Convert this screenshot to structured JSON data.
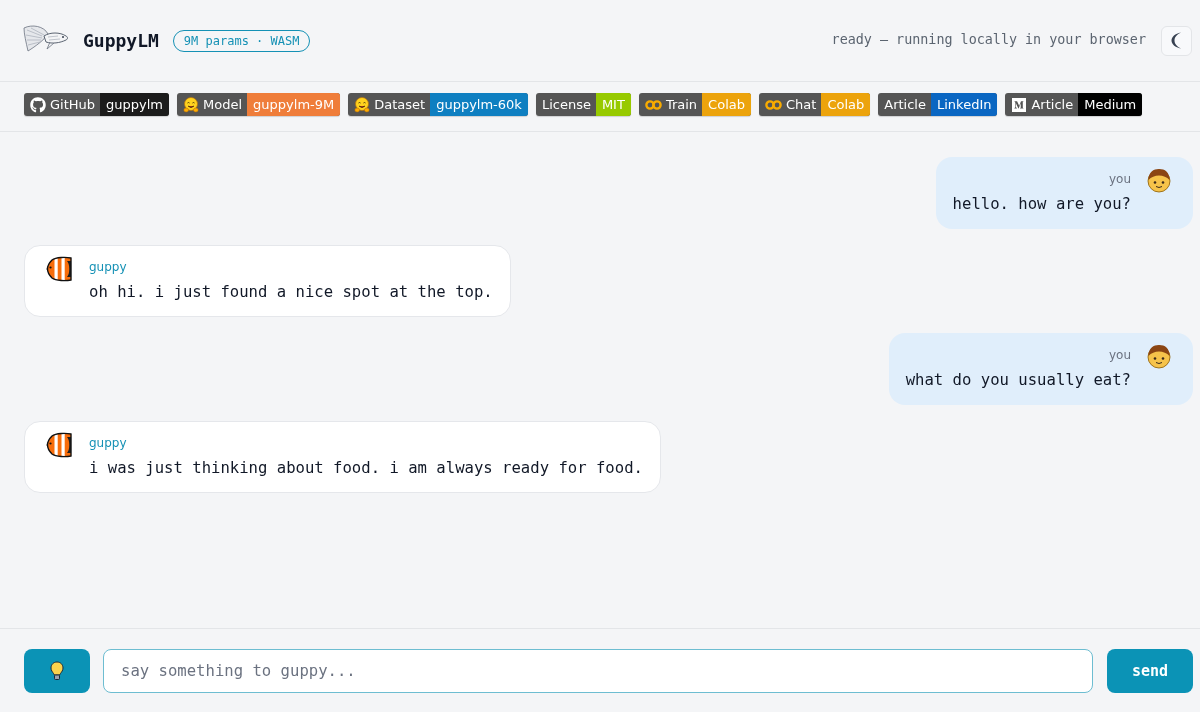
{
  "header": {
    "title": "GuppyLM",
    "tag": "9M params · WASM",
    "status": "ready — running locally in your browser"
  },
  "links": [
    {
      "kind": "github",
      "label": "GitHub",
      "value": "guppylm",
      "color": "#1c1c1c"
    },
    {
      "kind": "huggingface",
      "label": "Model",
      "value": "guppylm-9M",
      "color": "#ef7d3a"
    },
    {
      "kind": "huggingface",
      "label": "Dataset",
      "value": "guppylm-60k",
      "color": "#0e7fc1"
    },
    {
      "kind": "plain",
      "label": "License",
      "value": "MIT",
      "color": "#97ca00"
    },
    {
      "kind": "colab",
      "label": "Train",
      "value": "Colab",
      "color": "#eca30c"
    },
    {
      "kind": "colab",
      "label": "Chat",
      "value": "Colab",
      "color": "#eca30c"
    },
    {
      "kind": "plain",
      "label": "Article",
      "value": "LinkedIn",
      "color": "#0a66c2"
    },
    {
      "kind": "medium",
      "label": "Article",
      "value": "Medium",
      "color": "#000000"
    }
  ],
  "messages": [
    {
      "kind": "user",
      "sender": "you",
      "text": "hello. how are you?"
    },
    {
      "kind": "bot",
      "sender": "guppy",
      "text": "oh hi. i just found a nice spot at the top."
    },
    {
      "kind": "user",
      "sender": "you",
      "text": "what do you usually eat?"
    },
    {
      "kind": "bot",
      "sender": "guppy",
      "text": "i was just thinking about food. i am always ready for food."
    }
  ],
  "composer": {
    "placeholder": "say something to guppy...",
    "send": "send"
  }
}
